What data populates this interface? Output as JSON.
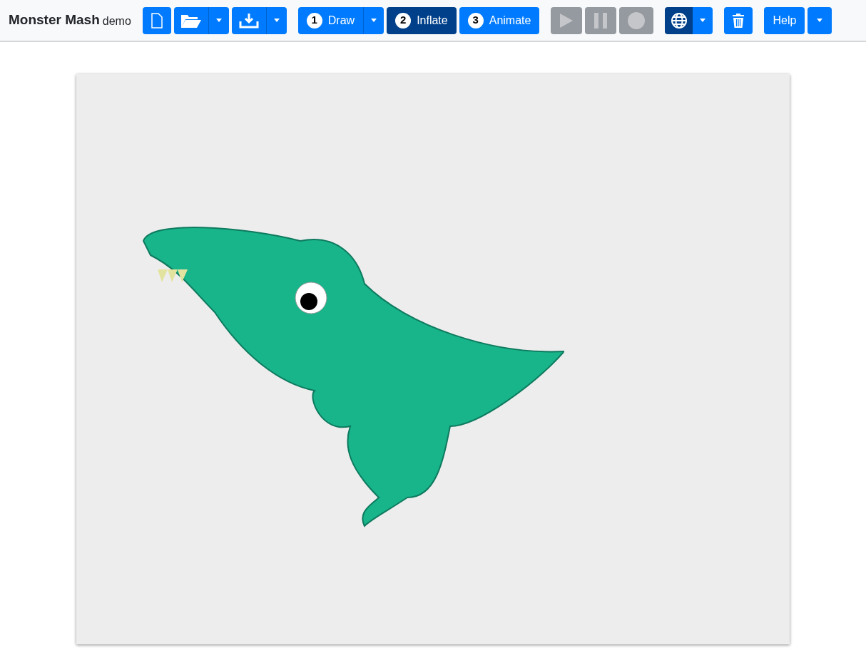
{
  "brand": {
    "title": "Monster Mash",
    "subtitle": "demo"
  },
  "steps": [
    {
      "number": "1",
      "label": "Draw",
      "selected": false,
      "has_menu": true
    },
    {
      "number": "2",
      "label": "Inflate",
      "selected": true,
      "has_menu": false
    },
    {
      "number": "3",
      "label": "Animate",
      "selected": false,
      "has_menu": false
    }
  ],
  "playback": {
    "disabled": true
  },
  "view_toggle": {
    "active": true
  },
  "help": {
    "label": "Help"
  }
}
